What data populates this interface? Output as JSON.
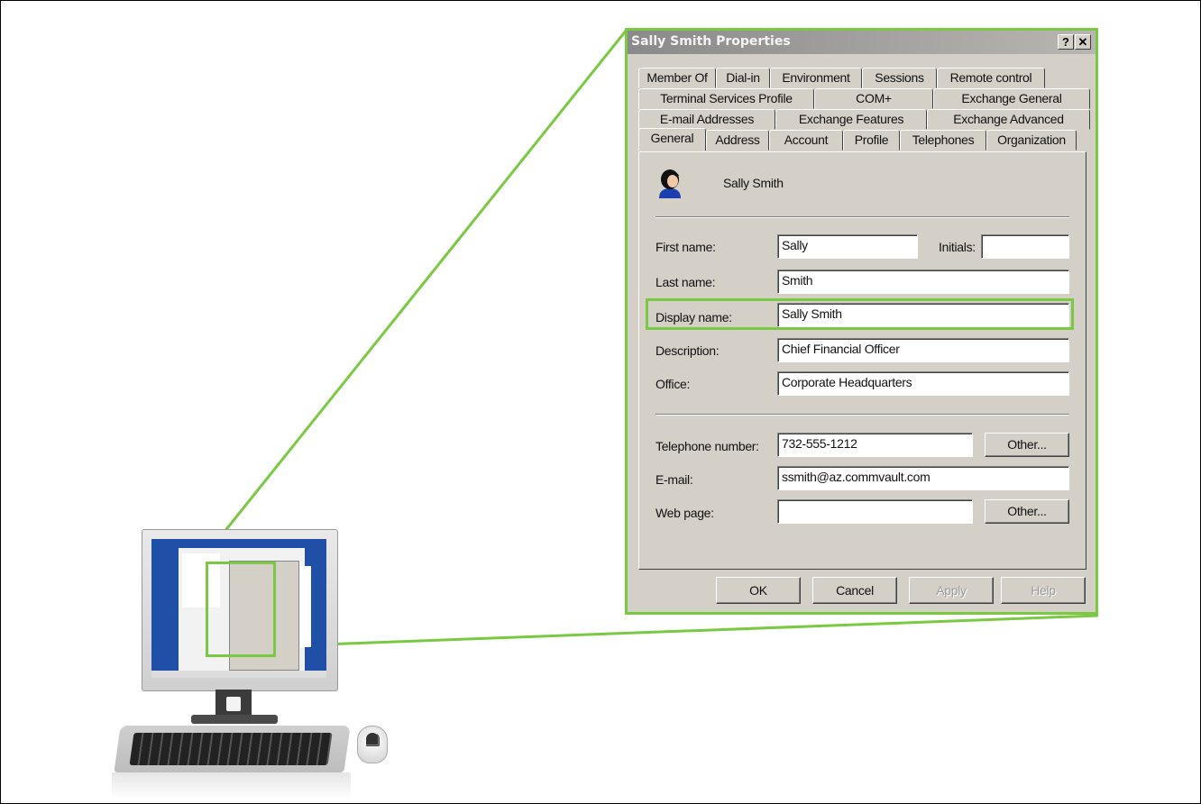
{
  "dialog": {
    "title": "Sally Smith Properties",
    "help_label": "?",
    "close_label": "✕",
    "tabs_row1": [
      "Member Of",
      "Dial-in",
      "Environment",
      "Sessions",
      "Remote control"
    ],
    "tabs_row2": [
      "Terminal Services Profile",
      "COM+",
      "Exchange General"
    ],
    "tabs_row3": [
      "E-mail Addresses",
      "Exchange Features",
      "Exchange Advanced"
    ],
    "tabs_row4": [
      "General",
      "Address",
      "Account",
      "Profile",
      "Telephones",
      "Organization"
    ],
    "user_name": "Sally Smith",
    "first_name": {
      "label": "First name:",
      "value": "Sally"
    },
    "initials": {
      "label": "Initials:",
      "value": ""
    },
    "last_name": {
      "label": "Last name:",
      "value": "Smith"
    },
    "display_name": {
      "label": "Display name:",
      "value": "Sally Smith"
    },
    "description": {
      "label": "Description:",
      "value": "Chief Financial Officer"
    },
    "office": {
      "label": "Office:",
      "value": "Corporate Headquarters"
    },
    "telephone": {
      "label": "Telephone number:",
      "value": "732-555-1212",
      "other_label": "Other..."
    },
    "email": {
      "label": "E-mail:",
      "value": "ssmith@az.commvault.com"
    },
    "web_page": {
      "label": "Web page:",
      "value": "",
      "other_label": "Other..."
    },
    "buttons": {
      "ok": "OK",
      "cancel": "Cancel",
      "apply": "Apply",
      "help": "Help"
    }
  },
  "colors": {
    "highlight": "#7ac943",
    "dialog_bg": "#d4d0c8",
    "desktop": "#1f4fa6"
  },
  "icons": [
    "user-icon",
    "monitor-icon",
    "keyboard-icon",
    "mouse-icon"
  ]
}
